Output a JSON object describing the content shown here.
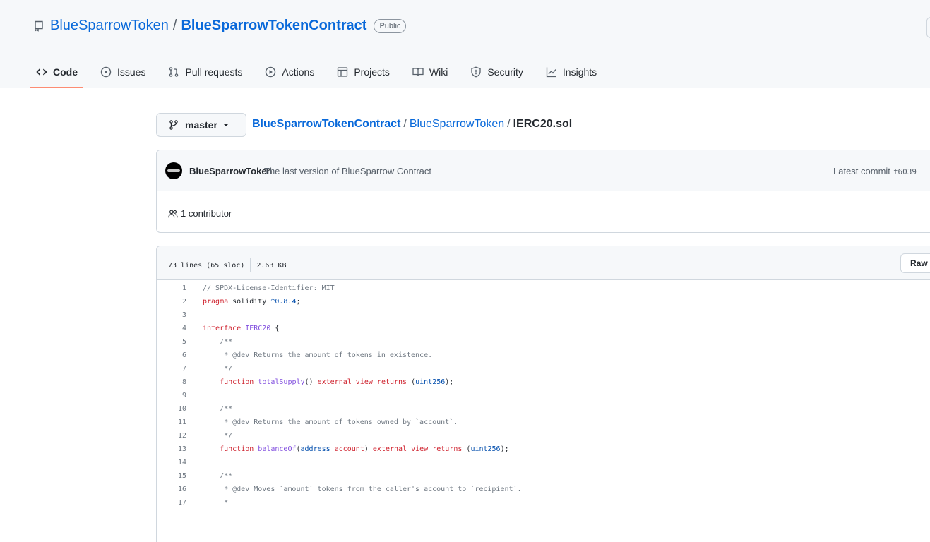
{
  "repo": {
    "owner": "BlueSparrowToken",
    "separator": "/",
    "name": "BlueSparrowTokenContract",
    "visibility": "Public"
  },
  "tabs": [
    {
      "label": "Code",
      "icon": "code-icon",
      "selected": true
    },
    {
      "label": "Issues",
      "icon": "issue-opened-icon"
    },
    {
      "label": "Pull requests",
      "icon": "git-pull-request-icon"
    },
    {
      "label": "Actions",
      "icon": "play-icon"
    },
    {
      "label": "Projects",
      "icon": "table-icon"
    },
    {
      "label": "Wiki",
      "icon": "book-icon"
    },
    {
      "label": "Security",
      "icon": "shield-icon"
    },
    {
      "label": "Insights",
      "icon": "graph-icon"
    }
  ],
  "branch": {
    "label": "master",
    "icon": "git-branch-icon"
  },
  "breadcrumb": {
    "repo": "BlueSparrowTokenContract",
    "sep": "/",
    "dir": "BlueSparrowToken",
    "file": "IERC20.sol"
  },
  "commit": {
    "author": "BlueSparrowToken",
    "message": "The last version of BlueSparrow Contract",
    "latest_label": "Latest commit",
    "sha": "f6039",
    "contributors": "1 contributor"
  },
  "file": {
    "lines": "73 lines (65 sloc)",
    "size": "2.63 KB",
    "raw_label": "Raw"
  },
  "code_lines": [
    {
      "n": "1",
      "tokens": [
        [
          "c",
          "// SPDX-License-Identifier: MIT"
        ]
      ]
    },
    {
      "n": "2",
      "tokens": [
        [
          "k",
          "pragma"
        ],
        [
          "",
          " solidity "
        ],
        [
          "n",
          "^0.8.4"
        ],
        [
          "",
          ";"
        ]
      ]
    },
    {
      "n": "3",
      "tokens": []
    },
    {
      "n": "4",
      "tokens": [
        [
          "k",
          "interface"
        ],
        [
          "",
          " "
        ],
        [
          "f",
          "IERC20"
        ],
        [
          "",
          " {"
        ]
      ]
    },
    {
      "n": "5",
      "tokens": [
        [
          "c",
          "    /**"
        ]
      ]
    },
    {
      "n": "6",
      "tokens": [
        [
          "c",
          "     * @dev Returns the amount of tokens in existence."
        ]
      ]
    },
    {
      "n": "7",
      "tokens": [
        [
          "c",
          "     */"
        ]
      ]
    },
    {
      "n": "8",
      "tokens": [
        [
          "",
          "    "
        ],
        [
          "k",
          "function"
        ],
        [
          "",
          " "
        ],
        [
          "f",
          "totalSupply"
        ],
        [
          "",
          "() "
        ],
        [
          "k",
          "external"
        ],
        [
          "",
          " "
        ],
        [
          "k",
          "view"
        ],
        [
          "",
          " "
        ],
        [
          "k",
          "returns"
        ],
        [
          "",
          " ("
        ],
        [
          "n",
          "uint256"
        ],
        [
          "",
          ");"
        ]
      ]
    },
    {
      "n": "9",
      "tokens": []
    },
    {
      "n": "10",
      "tokens": [
        [
          "c",
          "    /**"
        ]
      ]
    },
    {
      "n": "11",
      "tokens": [
        [
          "c",
          "     * @dev Returns the amount of tokens owned by `account`."
        ]
      ]
    },
    {
      "n": "12",
      "tokens": [
        [
          "c",
          "     */"
        ]
      ]
    },
    {
      "n": "13",
      "tokens": [
        [
          "",
          "    "
        ],
        [
          "k",
          "function"
        ],
        [
          "",
          " "
        ],
        [
          "f",
          "balanceOf"
        ],
        [
          "",
          "("
        ],
        [
          "n",
          "address"
        ],
        [
          "",
          " "
        ],
        [
          "k",
          "account"
        ],
        [
          "",
          ") "
        ],
        [
          "k",
          "external"
        ],
        [
          "",
          " "
        ],
        [
          "k",
          "view"
        ],
        [
          "",
          " "
        ],
        [
          "k",
          "returns"
        ],
        [
          "",
          " ("
        ],
        [
          "n",
          "uint256"
        ],
        [
          "",
          ");"
        ]
      ]
    },
    {
      "n": "14",
      "tokens": []
    },
    {
      "n": "15",
      "tokens": [
        [
          "c",
          "    /**"
        ]
      ]
    },
    {
      "n": "16",
      "tokens": [
        [
          "c",
          "     * @dev Moves `amount` tokens from the caller's account to `recipient`."
        ]
      ]
    },
    {
      "n": "17",
      "tokens": [
        [
          "c",
          "     *"
        ]
      ]
    }
  ]
}
